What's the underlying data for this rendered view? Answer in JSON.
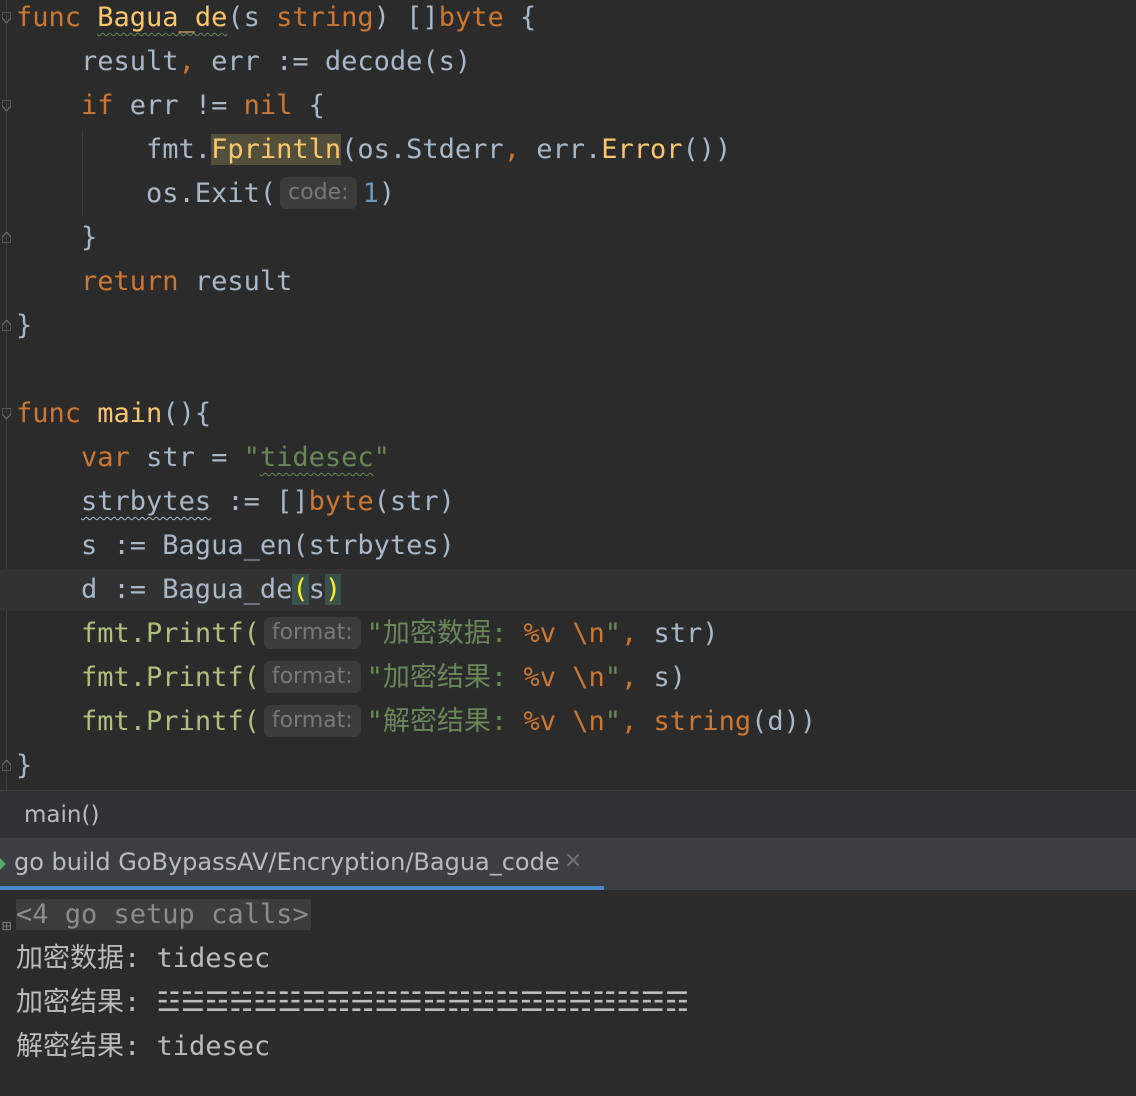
{
  "editor": {
    "lines": [
      {
        "id": "l1",
        "tokens": [
          {
            "t": "func ",
            "c": "kw"
          },
          {
            "t": "Bagua_de",
            "c": "fn wavy"
          },
          {
            "t": "(s ",
            "c": "ident"
          },
          {
            "t": "string",
            "c": "kw"
          },
          {
            "t": ") []",
            "c": "ident"
          },
          {
            "t": "byte",
            "c": "kw"
          },
          {
            "t": " {",
            "c": "ident"
          }
        ]
      },
      {
        "id": "l2",
        "tokens": [
          {
            "t": "    result",
            "c": "ident"
          },
          {
            "t": ",",
            "c": "kw"
          },
          {
            "t": " err := decode(s)",
            "c": "ident"
          }
        ]
      },
      {
        "id": "l3",
        "tokens": [
          {
            "t": "    ",
            "c": "ident"
          },
          {
            "t": "if",
            "c": "kw"
          },
          {
            "t": " err != ",
            "c": "ident"
          },
          {
            "t": "nil",
            "c": "kw"
          },
          {
            "t": " {",
            "c": "ident"
          }
        ]
      },
      {
        "id": "l4",
        "tokens": [
          {
            "t": "        fmt.",
            "c": "ident"
          },
          {
            "t": "Fprintln",
            "c": "meth hl"
          },
          {
            "t": "(os.Stderr",
            "c": "ident"
          },
          {
            "t": ",",
            "c": "kw"
          },
          {
            "t": " err.",
            "c": "ident"
          },
          {
            "t": "Error",
            "c": "meth"
          },
          {
            "t": "())",
            "c": "ident"
          }
        ]
      },
      {
        "id": "l5",
        "tokens": [
          {
            "t": "        os.Exit(",
            "c": "ident"
          },
          {
            "hint": "code:"
          },
          {
            "t": "1",
            "c": "num"
          },
          {
            "t": ")",
            "c": "ident"
          }
        ]
      },
      {
        "id": "l6",
        "tokens": [
          {
            "t": "    }",
            "c": "ident"
          }
        ]
      },
      {
        "id": "l7",
        "tokens": [
          {
            "t": "    ",
            "c": "ident"
          },
          {
            "t": "return",
            "c": "kw"
          },
          {
            "t": " result",
            "c": "ident"
          }
        ]
      },
      {
        "id": "l8",
        "tokens": [
          {
            "t": "}",
            "c": "ident"
          }
        ]
      },
      {
        "id": "l9",
        "tokens": []
      },
      {
        "id": "l10",
        "tokens": [
          {
            "t": "func ",
            "c": "kw"
          },
          {
            "t": "main",
            "c": "fn"
          },
          {
            "t": "(){",
            "c": "ident"
          }
        ]
      },
      {
        "id": "l11",
        "tokens": [
          {
            "t": "    ",
            "c": "ident"
          },
          {
            "t": "var",
            "c": "kw"
          },
          {
            "t": " str = ",
            "c": "ident"
          },
          {
            "t": "\"",
            "c": "str"
          },
          {
            "t": "tidesec",
            "c": "str wavy"
          },
          {
            "t": "\"",
            "c": "str"
          }
        ]
      },
      {
        "id": "l12",
        "tokens": [
          {
            "t": "    ",
            "c": "ident"
          },
          {
            "t": "strbytes",
            "c": "ident wavy2"
          },
          {
            "t": " := []",
            "c": "ident"
          },
          {
            "t": "byte",
            "c": "kw"
          },
          {
            "t": "(str)",
            "c": "ident"
          }
        ]
      },
      {
        "id": "l13",
        "tokens": [
          {
            "t": "    s := Bagua_en(strbytes)",
            "c": "ident"
          }
        ]
      },
      {
        "id": "l14",
        "tokens": [
          {
            "t": "    d := Bagua_de",
            "c": "ident"
          },
          {
            "t": "(",
            "c": "brace-hl"
          },
          {
            "t": "s",
            "c": "ident"
          },
          {
            "t": ")",
            "c": "brace-hl"
          }
        ]
      },
      {
        "id": "l15",
        "tokens": [
          {
            "t": "    ",
            "c": "ident"
          },
          {
            "t": "fmt.Printf(",
            "c": "pkg"
          },
          {
            "hint": "format:"
          },
          {
            "t": "\"加密数据: ",
            "c": "str"
          },
          {
            "t": "%v",
            "c": "kw"
          },
          {
            "t": " ",
            "c": "str"
          },
          {
            "t": "\\n",
            "c": "kw"
          },
          {
            "t": "\"",
            "c": "str"
          },
          {
            "t": ",",
            "c": "kw"
          },
          {
            "t": " str)",
            "c": "ident"
          }
        ]
      },
      {
        "id": "l16",
        "tokens": [
          {
            "t": "    ",
            "c": "ident"
          },
          {
            "t": "fmt.Printf(",
            "c": "pkg"
          },
          {
            "hint": "format:"
          },
          {
            "t": "\"加密结果: ",
            "c": "str"
          },
          {
            "t": "%v",
            "c": "kw"
          },
          {
            "t": " ",
            "c": "str"
          },
          {
            "t": "\\n",
            "c": "kw"
          },
          {
            "t": "\"",
            "c": "str"
          },
          {
            "t": ",",
            "c": "kw"
          },
          {
            "t": " s)",
            "c": "ident"
          }
        ]
      },
      {
        "id": "l17",
        "tokens": [
          {
            "t": "    ",
            "c": "ident"
          },
          {
            "t": "fmt.Printf(",
            "c": "pkg"
          },
          {
            "hint": "format:"
          },
          {
            "t": "\"解密结果: ",
            "c": "str"
          },
          {
            "t": "%v",
            "c": "kw"
          },
          {
            "t": " ",
            "c": "str"
          },
          {
            "t": "\\n",
            "c": "kw"
          },
          {
            "t": "\"",
            "c": "str"
          },
          {
            "t": ",",
            "c": "kw"
          },
          {
            "t": " ",
            "c": "ident"
          },
          {
            "t": "string",
            "c": "kw"
          },
          {
            "t": "(d))",
            "c": "ident"
          }
        ]
      },
      {
        "id": "l18",
        "tokens": [
          {
            "t": "}",
            "c": "ident"
          }
        ]
      }
    ]
  },
  "breadcrumb": {
    "label": "main()"
  },
  "run_panel": {
    "tab_label": "go build GoBypassAV/Encryption/Bagua_code",
    "close_glyph": "×"
  },
  "console": {
    "setup_calls": "<4 go setup calls>",
    "output_lines": [
      "加密数据: tidesec",
      "加密结果: ☳☱☲☵☳☳☲☶☵☳☱☲☵☳☳☲☶☵☳☳☲☶",
      "解密结果: tidesec"
    ]
  }
}
